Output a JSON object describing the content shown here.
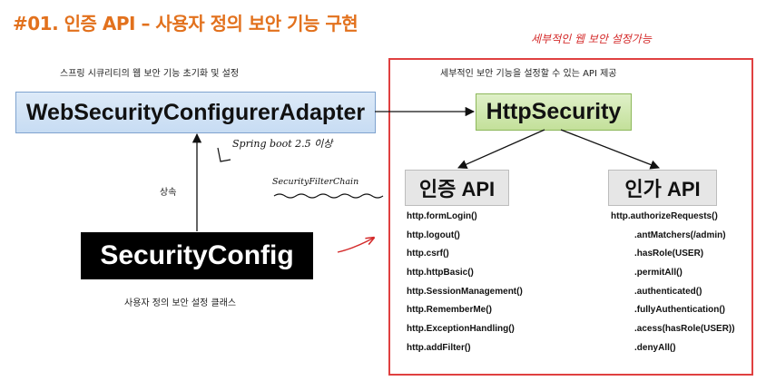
{
  "title": "#01. 인증 API – 사용자 정의 보안 기능 구현",
  "captions": {
    "left_top": "스프링 시큐리티의 웹 보안 기능 초기화 및 설정",
    "right_top": "세부적인 보안 기능을 설정할 수 있는 API 제공",
    "inherit": "상속",
    "bottom": "사용자 정의 보안 설정 클래스"
  },
  "boxes": {
    "adapter": "WebSecurityConfigurerAdapter",
    "http_security": "HttpSecurity",
    "security_config": "SecurityConfig",
    "authentication": "인증 API",
    "authorization": "인가 API"
  },
  "authentication_methods": [
    "http.formLogin()",
    "http.logout()",
    "http.csrf()",
    "http.httpBasic()",
    "http.SessionManagement()",
    "http.RememberMe()",
    "http.ExceptionHandling()",
    "http.addFilter()"
  ],
  "authorization_methods": [
    "http.authorizeRequests()",
    ".antMatchers(/admin)",
    ".hasRole(USER)",
    ".permitAll()",
    ".authenticated()",
    ".fullyAuthentication()",
    ".acess(hasRole(USER))",
    ".denyAll()"
  ],
  "handwritten": {
    "red_note": "세부적인 웹 보안 설정가능",
    "spring_note": "Spring boot 2.5 이상",
    "filter_note": "SecurityFilterChain"
  },
  "colors": {
    "title": "#e2711d",
    "adapter_fill": "#c7dcf3",
    "http_security_fill": "#c3e09a",
    "highlight_border": "#e04040"
  }
}
